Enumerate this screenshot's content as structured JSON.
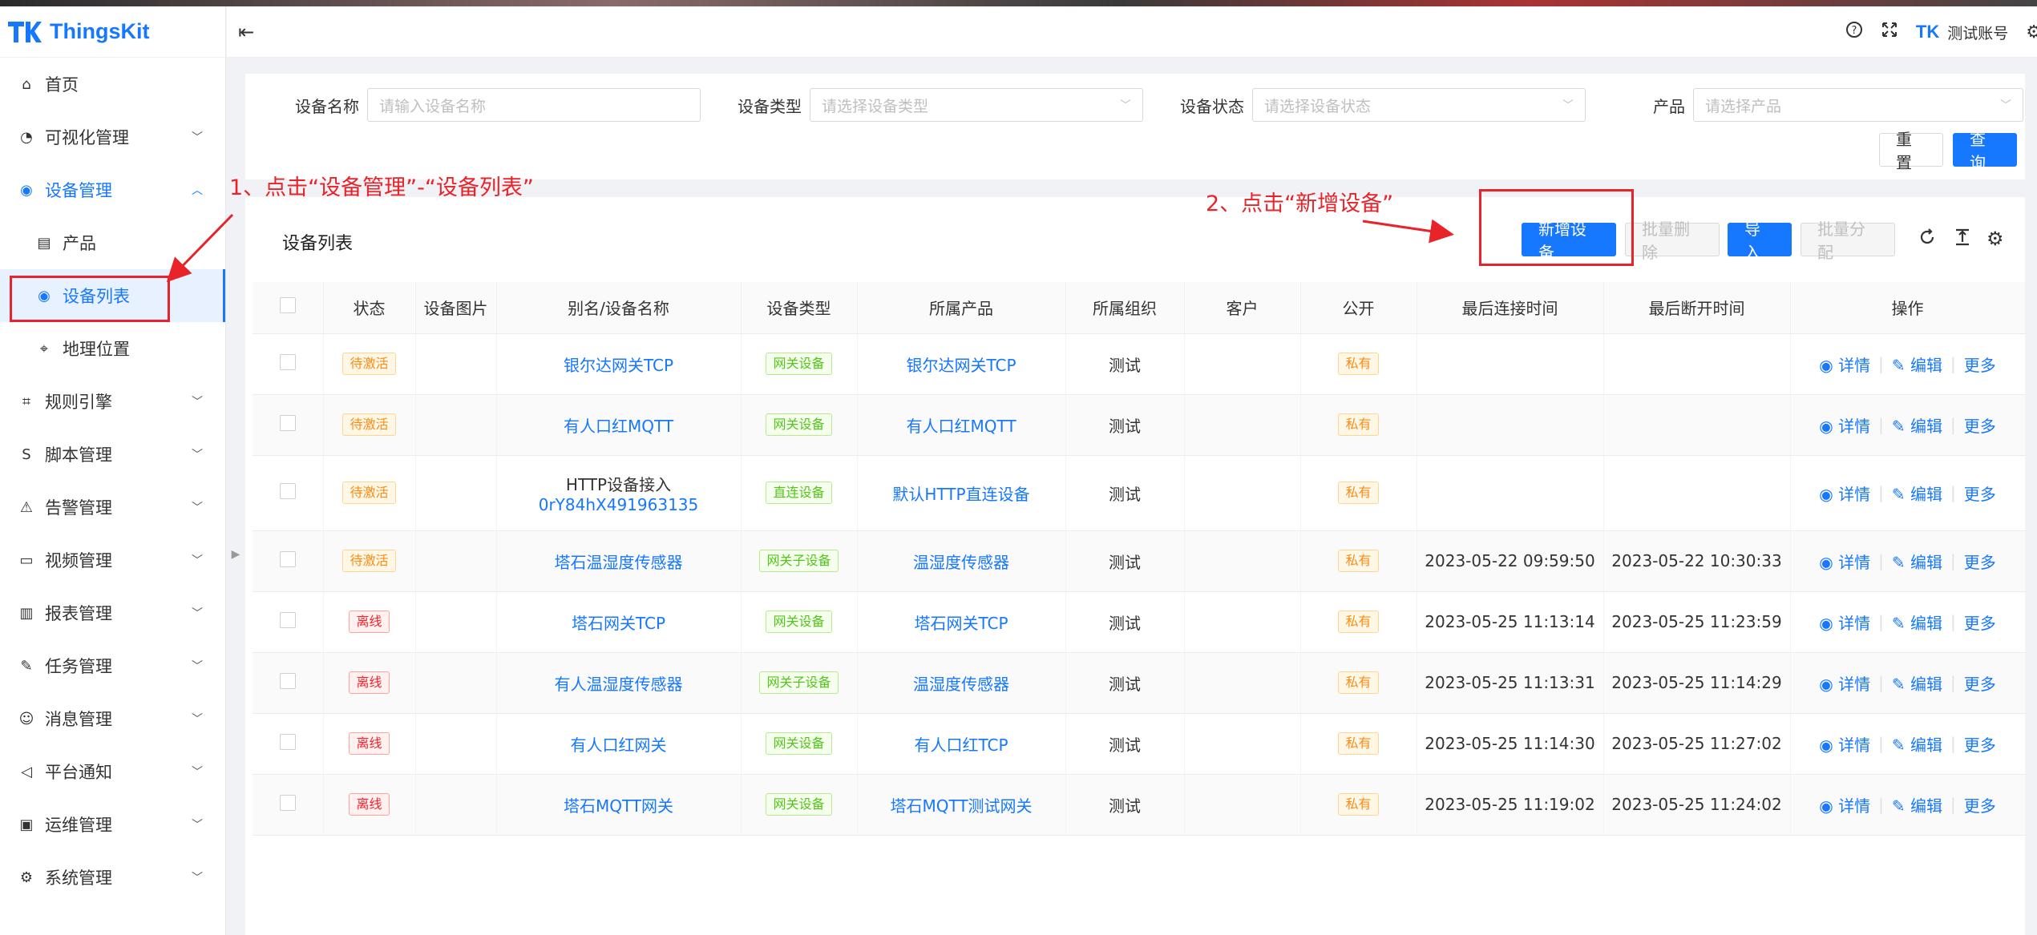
{
  "app": {
    "name": "ThingsKit"
  },
  "header": {
    "account": "测试账号",
    "account_logo": "TK"
  },
  "sidebar": {
    "items": [
      {
        "label": "首页",
        "icon": "home-icon"
      },
      {
        "label": "可视化管理",
        "icon": "dashboard-icon"
      },
      {
        "label": "设备管理",
        "icon": "device-icon"
      },
      {
        "label": "产品",
        "icon": "product-icon"
      },
      {
        "label": "设备列表",
        "icon": "device-list-icon"
      },
      {
        "label": "地理位置",
        "icon": "location-icon"
      },
      {
        "label": "规则引擎",
        "icon": "rule-icon"
      },
      {
        "label": "脚本管理",
        "icon": "script-icon"
      },
      {
        "label": "告警管理",
        "icon": "alarm-icon"
      },
      {
        "label": "视频管理",
        "icon": "video-icon"
      },
      {
        "label": "报表管理",
        "icon": "report-icon"
      },
      {
        "label": "任务管理",
        "icon": "task-icon"
      },
      {
        "label": "消息管理",
        "icon": "message-icon"
      },
      {
        "label": "平台通知",
        "icon": "notice-icon"
      },
      {
        "label": "运维管理",
        "icon": "ops-icon"
      },
      {
        "label": "系统管理",
        "icon": "system-icon"
      }
    ]
  },
  "search": {
    "device_name": {
      "label": "设备名称",
      "placeholder": "请输入设备名称"
    },
    "device_type": {
      "label": "设备类型",
      "placeholder": "请选择设备类型"
    },
    "device_status": {
      "label": "设备状态",
      "placeholder": "请选择设备状态"
    },
    "product": {
      "label": "产品",
      "placeholder": "请选择产品"
    },
    "reset": "重置",
    "query": "查询"
  },
  "list": {
    "title": "设备列表",
    "buttons": {
      "add": "新增设备",
      "batch_delete": "批量删除",
      "import": "导入",
      "batch_assign": "批量分配"
    },
    "columns": [
      "状态",
      "设备图片",
      "别名/设备名称",
      "设备类型",
      "所属产品",
      "所属组织",
      "客户",
      "公开",
      "最后连接时间",
      "最后断开时间",
      "操作"
    ],
    "ops": {
      "detail": "详情",
      "edit": "编辑",
      "more": "更多"
    },
    "rows": [
      {
        "status": "待激活",
        "status_color": "orange",
        "name": "银尔达网关TCP",
        "name2": "",
        "type": "网关设备",
        "product": "银尔达网关TCP",
        "org": "测试",
        "customer": "",
        "public": "私有",
        "last_conn": "",
        "last_disc": ""
      },
      {
        "status": "待激活",
        "status_color": "orange",
        "name": "有人口红MQTT",
        "name2": "",
        "type": "网关设备",
        "product": "有人口红MQTT",
        "org": "测试",
        "customer": "",
        "public": "私有",
        "last_conn": "",
        "last_disc": ""
      },
      {
        "status": "待激活",
        "status_color": "orange",
        "name": "HTTP设备接入",
        "name2": "0rY84hX491963135",
        "type": "直连设备",
        "product": "默认HTTP直连设备",
        "org": "测试",
        "customer": "",
        "public": "私有",
        "last_conn": "",
        "last_disc": ""
      },
      {
        "status": "待激活",
        "status_color": "orange",
        "name": "塔石温湿度传感器",
        "name2": "",
        "type": "网关子设备",
        "product": "温湿度传感器",
        "org": "测试",
        "customer": "",
        "public": "私有",
        "last_conn": "2023-05-22 09:59:50",
        "last_disc": "2023-05-22 10:30:33"
      },
      {
        "status": "离线",
        "status_color": "red",
        "name": "塔石网关TCP",
        "name2": "",
        "type": "网关设备",
        "product": "塔石网关TCP",
        "org": "测试",
        "customer": "",
        "public": "私有",
        "last_conn": "2023-05-25 11:13:14",
        "last_disc": "2023-05-25 11:23:59"
      },
      {
        "status": "离线",
        "status_color": "red",
        "name": "有人温湿度传感器",
        "name2": "",
        "type": "网关子设备",
        "product": "温湿度传感器",
        "org": "测试",
        "customer": "",
        "public": "私有",
        "last_conn": "2023-05-25 11:13:31",
        "last_disc": "2023-05-25 11:14:29"
      },
      {
        "status": "离线",
        "status_color": "red",
        "name": "有人口红网关",
        "name2": "",
        "type": "网关设备",
        "product": "有人口红TCP",
        "org": "测试",
        "customer": "",
        "public": "私有",
        "last_conn": "2023-05-25 11:14:30",
        "last_disc": "2023-05-25 11:27:02"
      },
      {
        "status": "离线",
        "status_color": "red",
        "name": "塔石MQTT网关",
        "name2": "",
        "type": "网关设备",
        "product": "塔石MQTT测试网关",
        "org": "测试",
        "customer": "",
        "public": "私有",
        "last_conn": "2023-05-25 11:19:02",
        "last_disc": "2023-05-25 11:24:02"
      }
    ]
  },
  "annotations": {
    "step1": "1、点击“设备管理”-“设备列表”",
    "step2": "2、点击“新增设备”",
    "color": "#e8232a"
  }
}
